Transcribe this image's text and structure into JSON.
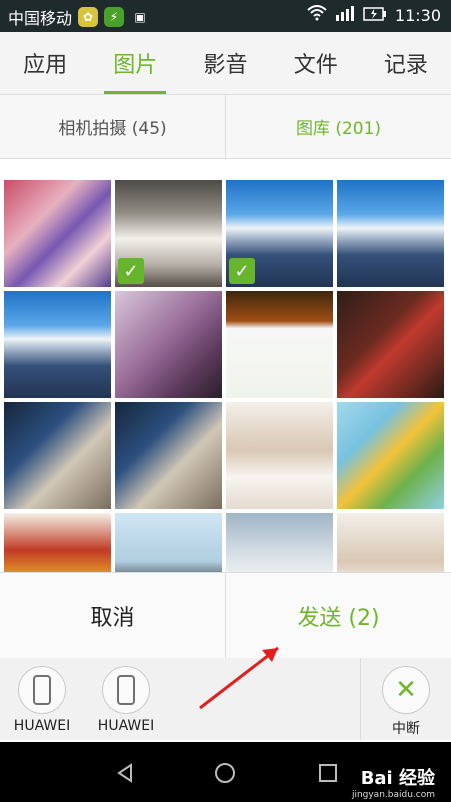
{
  "status_bar": {
    "carrier": "中国移动",
    "time": "11:30"
  },
  "top_tabs": [
    {
      "label": "应用",
      "active": false
    },
    {
      "label": "图片",
      "active": true
    },
    {
      "label": "影音",
      "active": false
    },
    {
      "label": "文件",
      "active": false
    },
    {
      "label": "记录",
      "active": false
    }
  ],
  "sub_tabs": [
    {
      "label": "相机拍摄 (45)",
      "active": false
    },
    {
      "label": "图库 (201)",
      "active": true
    }
  ],
  "actions": {
    "cancel_label": "取消",
    "send_label": "发送 (2)"
  },
  "devices": [
    {
      "label": "HUAWEI"
    },
    {
      "label": "HUAWEI"
    }
  ],
  "interrupt_label": "中断",
  "watermark": {
    "brand": "Bai 经验",
    "url": "jingyan.baidu.com"
  },
  "colors": {
    "accent": "#6fb62b",
    "status_bar": "#1f2a2d",
    "check_badge": "#66b52d"
  }
}
